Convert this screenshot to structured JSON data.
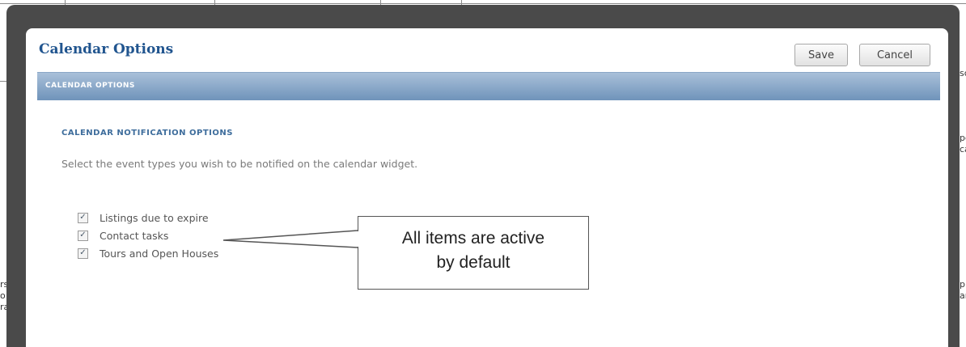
{
  "modal": {
    "title": "Calendar Options",
    "save_label": "Save",
    "cancel_label": "Cancel",
    "section_header": "CALENDAR OPTIONS"
  },
  "notifications": {
    "heading": "CALENDAR NOTIFICATION OPTIONS",
    "description": "Select the event types you wish to be notified on the calendar widget.",
    "options": [
      {
        "label": "Listings due to expire",
        "checked": true
      },
      {
        "label": "Contact tasks",
        "checked": true
      },
      {
        "label": "Tours and Open Houses",
        "checked": true
      }
    ]
  },
  "callout": {
    "line1": "All items are active",
    "line2": "by default"
  },
  "colors": {
    "title": "#21558f",
    "section_bar": "#7c9bc0",
    "overlay": "#4a4a4a"
  }
}
